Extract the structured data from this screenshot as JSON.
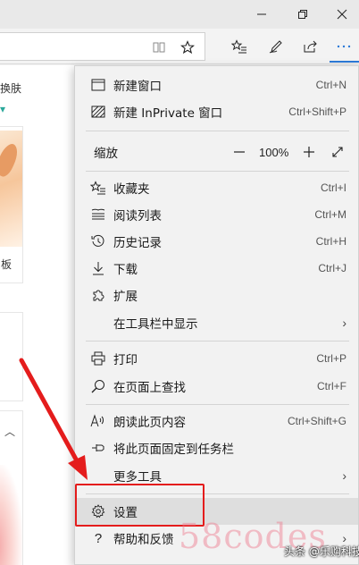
{
  "titlebar": {
    "minimize_icon": "minimize-icon",
    "restore_icon": "restore-icon",
    "close_icon": "close-icon"
  },
  "toolbar": {
    "reading_view_icon": "book-icon",
    "favorite_icon": "star-icon",
    "favorites_hub_icon": "favorites-list-icon",
    "notes_icon": "pen-icon",
    "share_icon": "share-icon",
    "more_icon": "ellipsis-icon",
    "accent": "#2b79d8"
  },
  "page": {
    "skin_text": "换肤",
    "card1_label": "板"
  },
  "menu": {
    "items_top": [
      {
        "icon": "new-window-icon",
        "label": "新建窗口",
        "shortcut": "Ctrl+N"
      },
      {
        "icon": "inprivate-icon",
        "label": "新建 InPrivate 窗口",
        "shortcut": "Ctrl+Shift+P"
      }
    ],
    "zoom": {
      "label": "缩放",
      "minus": "—",
      "value": "100%",
      "plus": "+",
      "fullscreen_icon": "expand-icon"
    },
    "items_mid": [
      {
        "icon": "favorites-icon",
        "label": "收藏夹",
        "shortcut": "Ctrl+I"
      },
      {
        "icon": "reading-list-icon",
        "label": "阅读列表",
        "shortcut": "Ctrl+M"
      },
      {
        "icon": "history-icon",
        "label": "历史记录",
        "shortcut": "Ctrl+H"
      },
      {
        "icon": "download-icon",
        "label": "下载",
        "shortcut": "Ctrl+J"
      },
      {
        "icon": "extensions-icon",
        "label": "扩展",
        "shortcut": ""
      },
      {
        "icon": "",
        "label": "在工具栏中显示",
        "shortcut": ""
      }
    ],
    "items_lower": [
      {
        "icon": "print-icon",
        "label": "打印",
        "shortcut": "Ctrl+P"
      },
      {
        "icon": "find-icon",
        "label": "在页面上查找",
        "shortcut": "Ctrl+F"
      },
      {
        "icon": "read-aloud-icon",
        "label": "朗读此页内容",
        "shortcut": "Ctrl+Shift+G"
      },
      {
        "icon": "pin-icon",
        "label": "将此页面固定到任务栏",
        "shortcut": ""
      },
      {
        "icon": "",
        "label": "更多工具",
        "shortcut": ""
      }
    ],
    "items_bottom": [
      {
        "icon": "settings-icon",
        "label": "设置",
        "shortcut": ""
      },
      {
        "icon": "help-icon",
        "label": "帮助和反馈",
        "shortcut": ""
      }
    ],
    "submenu_arrow": "›"
  },
  "annotation": {
    "highlight_color": "#e41c1c"
  },
  "overlay": {
    "watermark": "58codes",
    "credit": "头条 @乐购科技"
  }
}
